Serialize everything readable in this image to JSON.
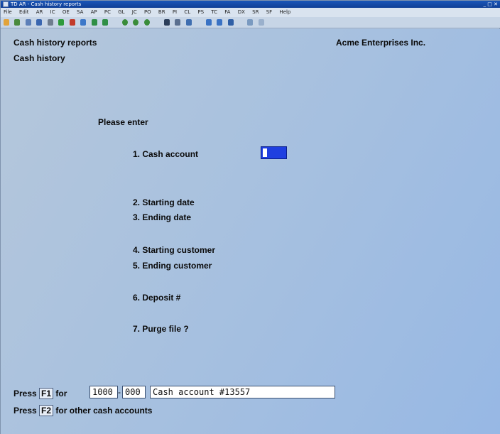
{
  "window": {
    "title": "TD AR - Cash history reports",
    "controls": "_ □ ✕"
  },
  "menu": {
    "items": [
      "File",
      "Edit",
      "AR",
      "IC",
      "OE",
      "SA",
      "AP",
      "PC",
      "GL",
      "JC",
      "PO",
      "BR",
      "PI",
      "CL",
      "PS",
      "TC",
      "FA",
      "DX",
      "SR",
      "SF",
      "Help"
    ]
  },
  "toolbar": {
    "icons": [
      "new-icon",
      "open-icon",
      "copy-icon",
      "paste-icon",
      "list-icon",
      "check-icon",
      "cancel-icon",
      "undo-icon",
      "up-icon",
      "down-icon",
      "circle-1-icon",
      "circle-2-icon",
      "circle-3-icon",
      "binoculars-icon",
      "find-icon",
      "refresh-icon",
      "prev-icon",
      "next-icon",
      "stop-icon",
      "print-icon",
      "help-icon"
    ]
  },
  "header": {
    "report_title": "Cash history reports",
    "subtitle": "Cash history",
    "company": "Acme Enterprises Inc."
  },
  "form": {
    "prompt": "Please enter",
    "fields": [
      {
        "label": "1. Cash account"
      },
      {
        "label": "2. Starting date"
      },
      {
        "label": "3. Ending date"
      },
      {
        "label": "4. Starting customer"
      },
      {
        "label": "5. Ending customer"
      },
      {
        "label": "6. Deposit #"
      },
      {
        "label": "7. Purge file ?"
      }
    ]
  },
  "footer": {
    "press_label": "Press",
    "f1_key": "F1",
    "for_label": "for",
    "account_main": "1000",
    "account_sub": "000",
    "account_description": "Cash account #13557",
    "f2_key": "F2",
    "f2_text": "for other cash accounts"
  }
}
